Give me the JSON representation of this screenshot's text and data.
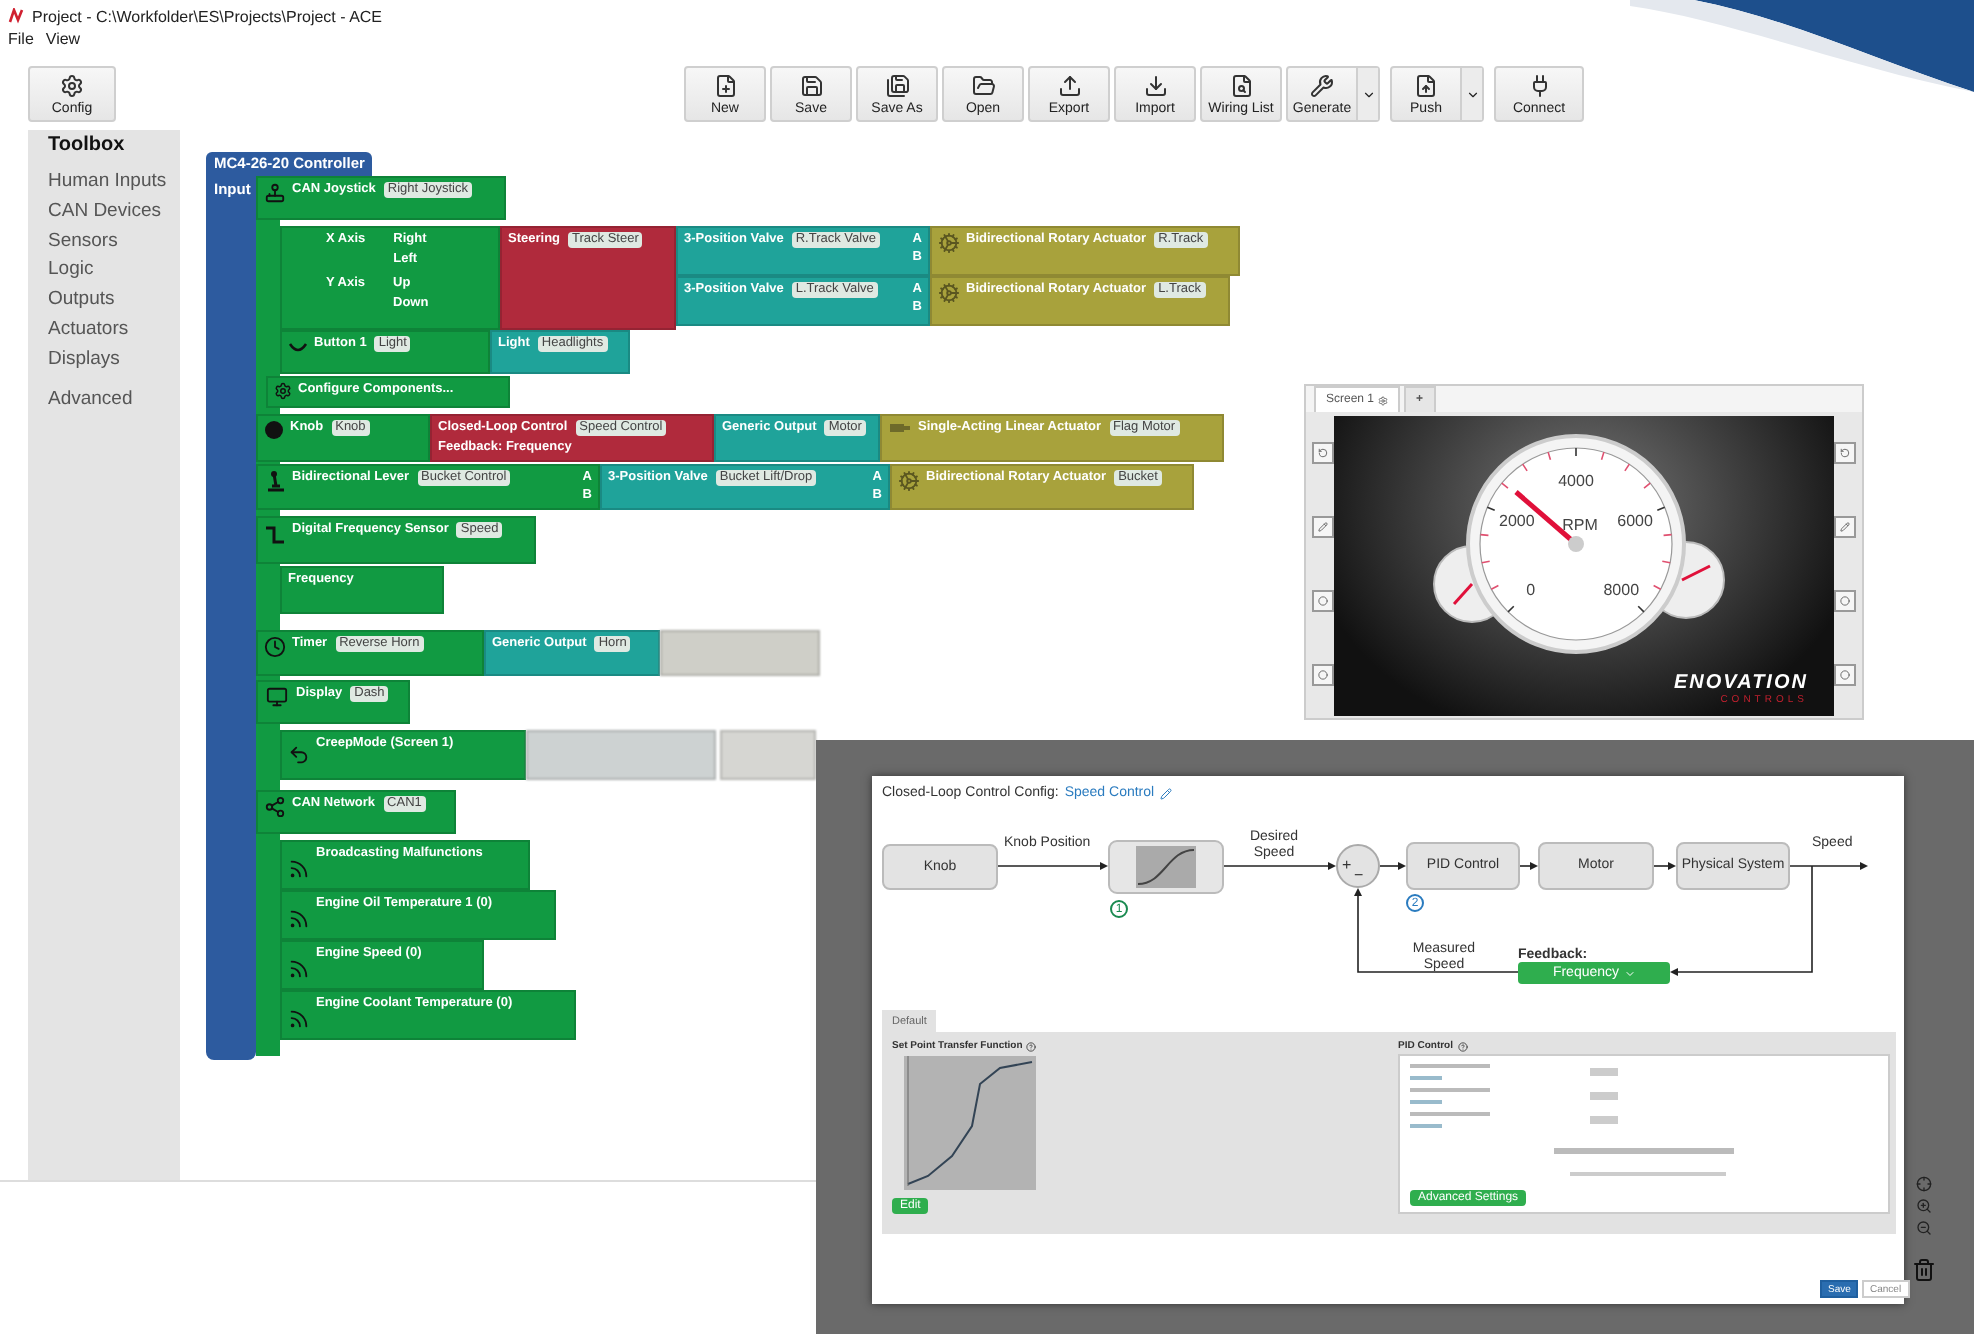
{
  "window": {
    "title": "Project - C:\\Workfolder\\ES\\Projects\\Project - ACE"
  },
  "menu": [
    "File",
    "View"
  ],
  "toolbar": {
    "config": "Config",
    "buttons": [
      {
        "label": "New",
        "dropdown": false
      },
      {
        "label": "Save",
        "dropdown": false
      },
      {
        "label": "Save As",
        "dropdown": false
      },
      {
        "label": "Open",
        "dropdown": false
      },
      {
        "label": "Export",
        "dropdown": false
      },
      {
        "label": "Import",
        "dropdown": false
      },
      {
        "label": "Wiring List",
        "dropdown": false
      },
      {
        "label": "Generate",
        "dropdown": true
      },
      {
        "label": "Push",
        "dropdown": true
      },
      {
        "label": "Connect",
        "dropdown": false
      }
    ]
  },
  "toolbox": {
    "title": "Toolbox",
    "items": [
      "Human Inputs",
      "CAN Devices",
      "Sensors",
      "Logic",
      "Outputs",
      "Actuators",
      "Displays",
      "Advanced"
    ]
  },
  "controller": {
    "title": "MC4-26-20 Controller",
    "input_label": "Input"
  },
  "blocks": [
    {
      "kind": "joystick",
      "color": "#119a42",
      "label": "CAN Joystick",
      "tag": "Right Joystick"
    },
    {
      "kind": "axes",
      "color": "#119a42",
      "axes": [
        {
          "label": "X Axis",
          "directions": [
            "Right",
            "Left"
          ]
        },
        {
          "label": "Y Axis",
          "directions": [
            "Up",
            "Down"
          ]
        }
      ]
    },
    {
      "kind": "plain",
      "color": "#b02a3c",
      "label": "Steering",
      "tag": "Track Steer"
    },
    {
      "kind": "plain",
      "color": "#1fa39a",
      "label": "3-Position Valve",
      "tag": "R.Track Valve",
      "ports": [
        "A",
        "B"
      ]
    },
    {
      "kind": "actuator",
      "color": "#a8a23c",
      "label": "Bidirectional Rotary Actuator",
      "tag": "R.Track"
    },
    {
      "kind": "plain",
      "color": "#1fa39a",
      "label": "3-Position Valve",
      "tag": "L.Track Valve",
      "ports": [
        "A",
        "B"
      ]
    },
    {
      "kind": "actuator",
      "color": "#a8a23c",
      "label": "Bidirectional Rotary Actuator",
      "tag": "L.Track"
    },
    {
      "kind": "button",
      "color": "#119a42",
      "label": "Button 1",
      "tag": "Light"
    },
    {
      "kind": "plain",
      "color": "#1fa39a",
      "label": "Light",
      "tag": "Headlights"
    },
    {
      "kind": "gear",
      "color": "#119a42",
      "label": "Configure Components..."
    },
    {
      "kind": "knob",
      "color": "#119a42",
      "label": "Knob",
      "tag": "Knob"
    },
    {
      "kind": "plain",
      "color": "#b02a3c",
      "label": "Closed-Loop Control",
      "tag": "Speed Control",
      "sub": "Feedback: Frequency"
    },
    {
      "kind": "plain",
      "color": "#1fa39a",
      "label": "Generic Output",
      "tag": "Motor"
    },
    {
      "kind": "linear",
      "color": "#a8a23c",
      "label": "Single-Acting Linear Actuator",
      "tag": "Flag Motor"
    },
    {
      "kind": "lever",
      "color": "#119a42",
      "label": "Bidirectional Lever",
      "tag": "Bucket Control",
      "ports": [
        "A",
        "B"
      ]
    },
    {
      "kind": "plain",
      "color": "#1fa39a",
      "label": "3-Position Valve",
      "tag": "Bucket Lift/Drop",
      "ports": [
        "A",
        "B"
      ]
    },
    {
      "kind": "actuator",
      "color": "#a8a23c",
      "label": "Bidirectional Rotary Actuator",
      "tag": "Bucket"
    },
    {
      "kind": "wave",
      "color": "#119a42",
      "label": "Digital Frequency Sensor",
      "tag": "Speed"
    },
    {
      "kind": "plain",
      "color": "#119a42",
      "label": "Frequency"
    },
    {
      "kind": "timer",
      "color": "#119a42",
      "label": "Timer",
      "tag": "Reverse Horn"
    },
    {
      "kind": "plain",
      "color": "#1fa39a",
      "label": "Generic Output",
      "tag": "Horn"
    },
    {
      "kind": "blurred",
      "color": "#cfcfc8"
    },
    {
      "kind": "display",
      "color": "#119a42",
      "label": "Display",
      "tag": "Dash"
    },
    {
      "kind": "back",
      "color": "#119a42",
      "label": "CreepMode (Screen 1)"
    },
    {
      "kind": "blurred",
      "color": "#cdd2d2"
    },
    {
      "kind": "blurred",
      "color": "#d6d6d2"
    },
    {
      "kind": "share",
      "color": "#119a42",
      "label": "CAN Network",
      "tag": "CAN1"
    },
    {
      "kind": "broadcast",
      "color": "#119a42",
      "label": "Broadcasting Malfunctions"
    },
    {
      "kind": "broadcast",
      "color": "#119a42",
      "label": "Engine Oil Temperature 1 (0)"
    },
    {
      "kind": "broadcast",
      "color": "#119a42",
      "label": "Engine Speed (0)"
    },
    {
      "kind": "broadcast",
      "color": "#119a42",
      "label": "Engine Coolant Temperature (0)"
    }
  ],
  "screen_editor": {
    "tabs": [
      {
        "label": "Screen 1",
        "selected": true
      },
      {
        "label": "+",
        "selected": false
      }
    ],
    "gauge": {
      "ticks": [
        "0",
        "2000",
        "4000",
        "6000",
        "8000"
      ],
      "unit": "RPM"
    },
    "logo": {
      "name": "ENOVATION",
      "sub": "CONTROLS"
    }
  },
  "dialog": {
    "title": "Closed-Loop Control Config:",
    "name": "Speed Control",
    "diagram": {
      "nodes": [
        "Knob",
        "PID Control",
        "Motor",
        "Physical System"
      ],
      "knob_position": "Knob Position",
      "desired_speed": "Desired Speed",
      "output": "Speed",
      "measured_speed": "Measured Speed",
      "feedback_label": "Feedback:",
      "feedback_value": "Frequency",
      "steps": [
        "1",
        "2"
      ],
      "plus": "+",
      "minus": "−"
    },
    "tab": "Default",
    "transfer_title": "Set Point Transfer Function",
    "edit": "Edit",
    "pid_title": "PID Control",
    "advanced": "Advanced Settings",
    "buttons": [
      "Save",
      "Cancel"
    ]
  }
}
